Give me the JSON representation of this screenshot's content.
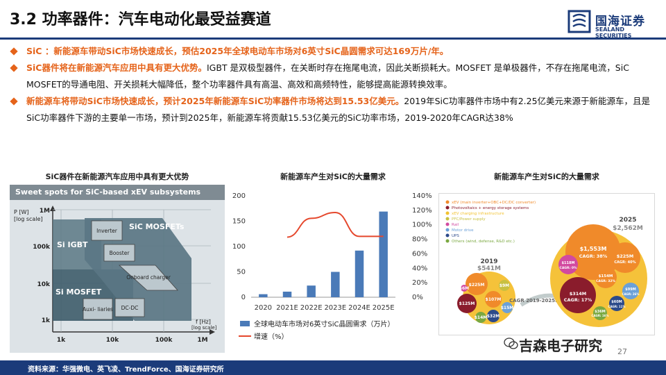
{
  "header": {
    "title": "3.2 功率器件：汽车电动化最受益赛道",
    "logo_cn": "国海证券",
    "logo_en": "SEALAND SECURITIES"
  },
  "bullets": [
    {
      "highlight": "SiC ：新能源车带动SiC市场快速成长，预估2025年全球电动车市场对6英寸SiC晶圆需求可达169万片/年。",
      "body": ""
    },
    {
      "highlight": "SiC器件将在新能源汽车应用中具有更大优势。",
      "body": "IGBT 是双极型器件，在关断时存在拖尾电流，因此关断损耗大。MOSFET 是单极器件，不存在拖尾电流，SiC MOSFET的导通电阻、开关损耗大幅降低，整个功率器件具有高温、高效和高频特性，能够提高能源转换效率。"
    },
    {
      "highlight": "新能源车将带动SiC市场快速成长，预计2025年新能源车SiC功率器件市场将达到15.53亿美元。",
      "body": "2019年SiC功率器件市场中有2.25亿美元来源于新能源车，且是SiC功率器件下游的主要单一市场，预计到2025年，新能源车将贡献15.53亿美元的SiC功率市场，2019-2020年CAGR达38%"
    }
  ],
  "panel1": {
    "title": "SiC器件在新能源汽车应用中具有更大优势",
    "header": "Sweet spots for SiC-based xEV subsystems",
    "ylabel_1": "P [W]",
    "ylabel_2": "[log scale]",
    "y_ticks": [
      "1M",
      "100k",
      "10k",
      "1k"
    ],
    "x_ticks": [
      "1k",
      "10k",
      "100k",
      "1M"
    ],
    "xlabel_1": "f [Hz]",
    "xlabel_2": "[log scale]",
    "regions": [
      "Si IGBT",
      "SiC MOSFETs",
      "Si MOSFET"
    ],
    "blocks": [
      "Inverter",
      "Booster",
      "Onboard charger",
      "Auxi- liaries",
      "DC-DC"
    ]
  },
  "chart_data": {
    "type": "bar",
    "title": "新能源车产生对SiC的大量需求",
    "categories": [
      "2020",
      "2021E",
      "2022E",
      "2023E",
      "2024E",
      "2025E"
    ],
    "series": [
      {
        "name": "全球电动车市场对6英寸SiC晶圆需求（万片）",
        "type": "bar",
        "axis": "left",
        "values": [
          6,
          11,
          23,
          50,
          92,
          169
        ],
        "color": "#4a7ab8"
      },
      {
        "name": "增速（%）",
        "type": "line",
        "axis": "right",
        "values": [
          null,
          83,
          109,
          117,
          84,
          84
        ],
        "color": "#e5472c"
      }
    ],
    "ylim": [
      0,
      200
    ],
    "y_ticks": [
      "0",
      "50",
      "100",
      "150",
      "200"
    ],
    "y2lim": [
      0,
      140
    ],
    "y2_ticks": [
      "0%",
      "20%",
      "40%",
      "60%",
      "80%",
      "100%",
      "120%",
      "140%"
    ],
    "legend": "bottom"
  },
  "panel3": {
    "title": "新能源车产生对SiC的大量需求",
    "legend": [
      {
        "label": "xEV (main inverter+OBC+DC/DC converter)",
        "color": "#f08a2a"
      },
      {
        "label": "Photovoltaics + energy storage systems",
        "color": "#8a1c2c"
      },
      {
        "label": "xEV charging infrastructure",
        "color": "#f2c230"
      },
      {
        "label": "PFC/Power supply",
        "color": "#c8c040"
      },
      {
        "label": "Rail",
        "color": "#d24aa0"
      },
      {
        "label": "Motor drive",
        "color": "#6aa0d8"
      },
      {
        "label": "UPS",
        "color": "#2c4a8a"
      },
      {
        "label": "Others (wind, defense, R&D etc.)",
        "color": "#7aa840"
      }
    ],
    "year_2019": "2019",
    "total_2019": "$541M",
    "year_2025": "2025",
    "total_2025": "$2,562M",
    "cagr_arrow": "CAGR 2019-2025: +30%",
    "bubbles_2019": [
      "$225M",
      "$9M",
      "$107M",
      "$125M",
      "$14M",
      "$32M",
      "$15M",
      "$6M"
    ],
    "bubbles_2025": [
      "$1,553M",
      "CAGR: 38%",
      "$314M",
      "CAGR: 17%",
      "$225M",
      "CAGR: 40%",
      "$154M",
      "CAGR: 32%",
      "$118M",
      "CAGR: 0%",
      "$99M",
      "CAGR: 26%",
      "$60M",
      "CAGR: 11%",
      "$36M",
      "CAGR: 16%"
    ]
  },
  "watermark": "吉森电子研究",
  "page_number": "27",
  "footer": "资料来源：华强微电、英飞凌、TrendForce、国海证券研究所"
}
